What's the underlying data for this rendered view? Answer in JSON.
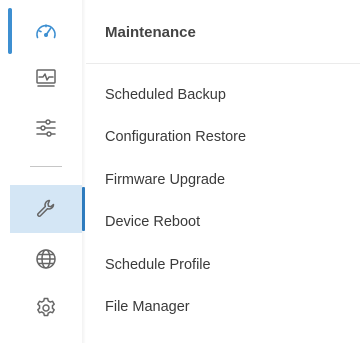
{
  "rail": {
    "icons": [
      {
        "name": "dashboard",
        "icon": "speedometer-icon"
      },
      {
        "name": "monitor",
        "icon": "monitor-pulse-icon"
      },
      {
        "name": "settings",
        "icon": "sliders-icon"
      },
      {
        "name": "maintenance",
        "icon": "wrench-icon",
        "active": true
      },
      {
        "name": "network",
        "icon": "globe-icon"
      },
      {
        "name": "system",
        "icon": "gear-icon"
      }
    ],
    "accent_color": "#3d8fd1",
    "active_bg": "#d4e6f5",
    "active_bar_color": "#2f7fc4"
  },
  "menu": {
    "title": "Maintenance",
    "items": [
      {
        "label": "Scheduled Backup"
      },
      {
        "label": "Configuration Restore"
      },
      {
        "label": "Firmware Upgrade"
      },
      {
        "label": "Device Reboot"
      },
      {
        "label": "Schedule Profile"
      },
      {
        "label": "File Manager"
      }
    ]
  }
}
